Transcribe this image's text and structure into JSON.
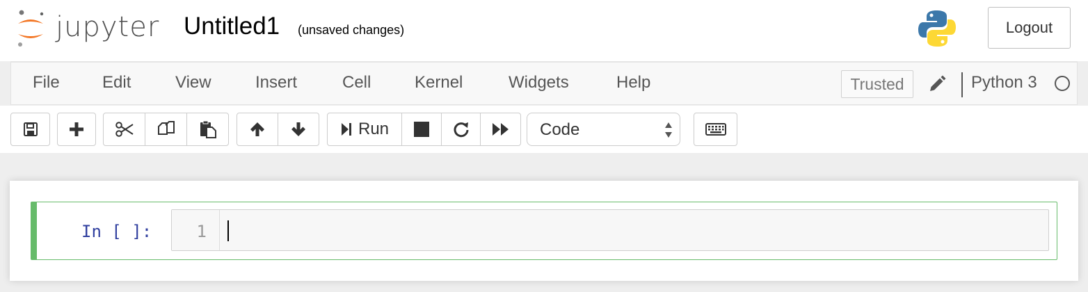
{
  "header": {
    "logo_text": "jupyter",
    "notebook_title": "Untitled1",
    "save_status": "(unsaved changes)",
    "logout_label": "Logout",
    "kernel_logo_icon": "python-logo-icon"
  },
  "menubar": {
    "items": [
      {
        "label": "File"
      },
      {
        "label": "Edit"
      },
      {
        "label": "View"
      },
      {
        "label": "Insert"
      },
      {
        "label": "Cell"
      },
      {
        "label": "Kernel"
      },
      {
        "label": "Widgets"
      },
      {
        "label": "Help"
      }
    ],
    "trusted_label": "Trusted",
    "kernel_name": "Python 3",
    "edit_icon": "pencil-icon",
    "kernel_indicator_icon": "kernel-idle-circle-icon"
  },
  "toolbar": {
    "run_label": "Run",
    "cell_type": "Code",
    "icons": [
      "save-icon",
      "plus-icon",
      "cut-icon",
      "copy-icon",
      "paste-icon",
      "arrow-up-icon",
      "arrow-down-icon",
      "step-forward-icon",
      "stop-icon",
      "restart-icon",
      "fast-forward-icon",
      "keyboard-icon"
    ]
  },
  "cell": {
    "prompt": "In [ ]:",
    "line_number": "1",
    "source": ""
  },
  "colors": {
    "cell_selected_border": "#66bb6a",
    "prompt": "#303f9f",
    "background": "#eeeeee",
    "jupyter_orange": "#f37726"
  }
}
